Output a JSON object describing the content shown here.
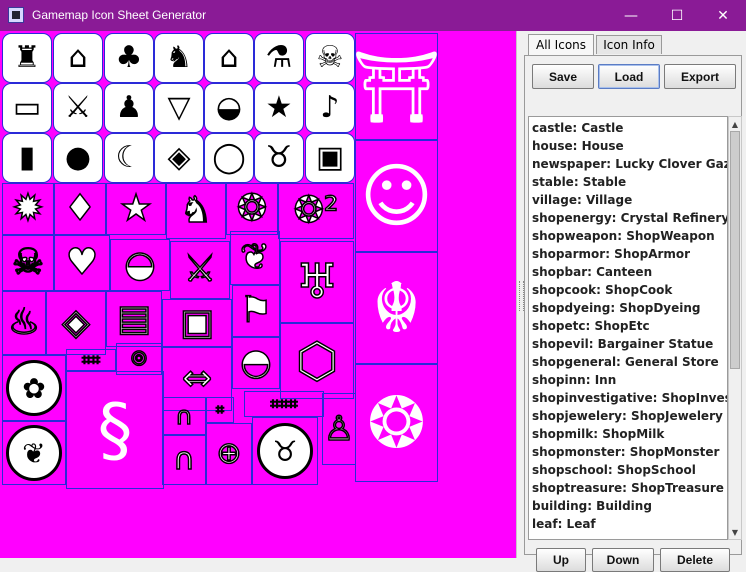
{
  "window": {
    "title": "Gamemap Icon Sheet Generator",
    "minimize_glyph": "—",
    "maximize_glyph": "☐",
    "close_glyph": "✕"
  },
  "tabs": [
    {
      "label": "All Icons",
      "active": true
    },
    {
      "label": "Icon Info",
      "active": false
    }
  ],
  "toolbar": {
    "save_label": "Save",
    "load_label": "Load",
    "export_label": "Export"
  },
  "bottom_buttons": {
    "up_label": "Up",
    "down_label": "Down",
    "delete_label": "Delete"
  },
  "icon_list": [
    "castle: Castle",
    "house: House",
    "newspaper: Lucky Clover Gazette",
    "stable: Stable",
    "village: Village",
    "shopenergy: Crystal Refinery",
    "shopweapon: ShopWeapon",
    "shoparmor: ShopArmor",
    "shopbar: Canteen",
    "shopcook: ShopCook",
    "shopdyeing: ShopDyeing",
    "shopetc: ShopEtc",
    "shopevil: Bargainer Statue",
    "shopgeneral: General Store",
    "shopinn: Inn",
    "shopinvestigative: ShopInvestiga...",
    "shopjewelery: ShopJewelery",
    "shopmilk: ShopMilk",
    "shopmonster: ShopMonster",
    "shopschool: ShopSchool",
    "shoptreasure: ShopTreasure",
    "building: Building",
    "leaf: Leaf"
  ],
  "sheet_icons": {
    "row1": [
      "castle-icon",
      "mushroom-icon",
      "clover-icon",
      "horse-head-icon",
      "house-icon",
      "vial-icon",
      "skull-icon"
    ],
    "row2": [
      "battery-icon",
      "sword-icon",
      "tunic-icon",
      "cocktail-icon",
      "pot-icon",
      "star-icon",
      "bell-icon"
    ],
    "row3": [
      "bottle-icon",
      "vase-icon",
      "moon-icon",
      "compass-icon",
      "ring-icon",
      "bull-icon",
      "chest-icon"
    ]
  },
  "colors": {
    "titlebar": "#8a1b96",
    "canvas_bg": "#ff00ff",
    "cell_border": "#2a2ad8"
  }
}
